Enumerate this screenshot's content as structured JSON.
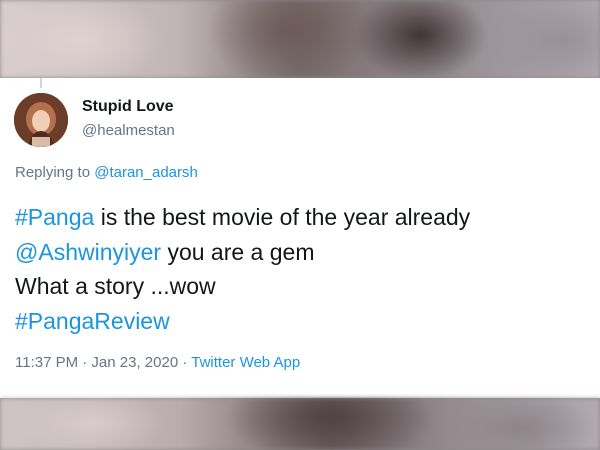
{
  "tweet": {
    "display_name": "Stupid Love",
    "handle": "@healmestan",
    "replying_prefix": "Replying to",
    "replying_to": "@taran_adarsh",
    "lines": [
      {
        "tag": "#Panga",
        "text": " is the best movie of the year already"
      },
      {
        "mention": "@Ashwinyiyer",
        "text": " you are a gem"
      },
      {
        "text": "What a story ...wow"
      },
      {
        "tag": "#PangaReview"
      }
    ],
    "time": "11:37 PM · Jan 23, 2020 · ",
    "source": "Twitter Web App"
  },
  "colors": {
    "link": "#1b95e0",
    "secondary_text": "#657786",
    "primary_text": "#14171a",
    "card_bg": "#ffffff"
  },
  "icons": {
    "avatar": "profile-photo"
  }
}
